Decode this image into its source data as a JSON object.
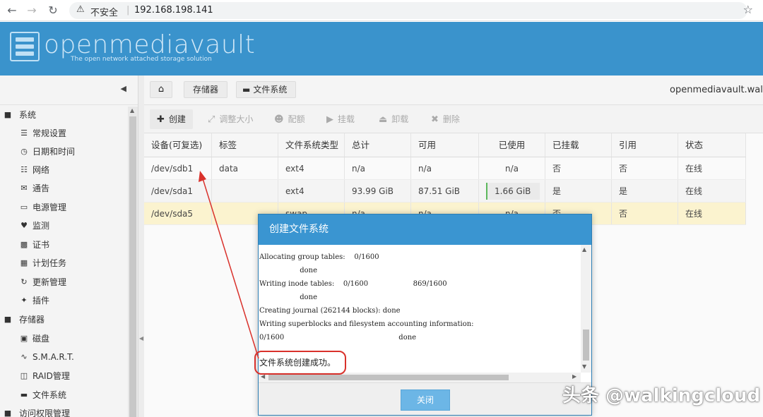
{
  "browser": {
    "insecure_label": "不安全",
    "separator": "|",
    "url": "192.168.198.141"
  },
  "app": {
    "logo_text": "openmediavault",
    "tagline": "The open network attached storage solution",
    "accent": "#3a93cc"
  },
  "sidebar": {
    "groups": [
      {
        "label": "系统",
        "icon": "minus-square-icon"
      },
      {
        "label": "存储器",
        "icon": "minus-square-icon"
      },
      {
        "label": "访问权限管理",
        "icon": "minus-square-icon"
      }
    ],
    "items": [
      {
        "label": "常规设置",
        "icon": "sliders-icon"
      },
      {
        "label": "日期和时间",
        "icon": "clock-icon"
      },
      {
        "label": "网络",
        "icon": "network-icon"
      },
      {
        "label": "通告",
        "icon": "envelope-icon"
      },
      {
        "label": "电源管理",
        "icon": "battery-icon"
      },
      {
        "label": "监测",
        "icon": "heartbeat-icon"
      },
      {
        "label": "证书",
        "icon": "certificate-icon"
      },
      {
        "label": "计划任务",
        "icon": "calendar-icon"
      },
      {
        "label": "更新管理",
        "icon": "refresh-icon"
      },
      {
        "label": "插件",
        "icon": "puzzle-icon"
      },
      {
        "label": "磁盘",
        "icon": "disk-icon"
      },
      {
        "label": "S.M.A.R.T.",
        "icon": "pulse-icon"
      },
      {
        "label": "RAID管理",
        "icon": "database-icon"
      },
      {
        "label": "文件系统",
        "icon": "folder-icon"
      }
    ]
  },
  "breadcrumb": {
    "items": [
      "存储器",
      "文件系统"
    ],
    "hostname": "openmediavault.walkin"
  },
  "toolbar": {
    "create": "创建",
    "resize": "调整大小",
    "quota": "配额",
    "mount": "挂载",
    "unmount": "卸载",
    "delete": "删除"
  },
  "table": {
    "headers": [
      "设备(可复选)",
      "标签",
      "文件系统类型",
      "总计",
      "可用",
      "已使用",
      "已挂载",
      "引用",
      "状态"
    ],
    "rows": [
      [
        "/dev/sdb1",
        "data",
        "ext4",
        "n/a",
        "n/a",
        "n/a",
        "否",
        "否",
        "在线"
      ],
      [
        "/dev/sda1",
        "",
        "ext4",
        "93.99 GiB",
        "87.51 GiB",
        "1.66 GiB",
        "是",
        "是",
        "在线"
      ],
      [
        "/dev/sda5",
        "",
        "swap",
        "n/a",
        "n/a",
        "n/a",
        "否",
        "否",
        "在线"
      ]
    ]
  },
  "dialog": {
    "title": "创建文件系统",
    "log": "Allocating group tables:    0/1600\n                  done\nWriting inode tables:    0/1600                    869/1600\n                  done\nCreating journal (262144 blocks): done\nWriting superblocks and filesystem accounting information:\n0/1600                                                   done",
    "success": "文件系统创建成功。",
    "close_label": "关闭"
  },
  "watermark": "头条 @walkingcloud"
}
